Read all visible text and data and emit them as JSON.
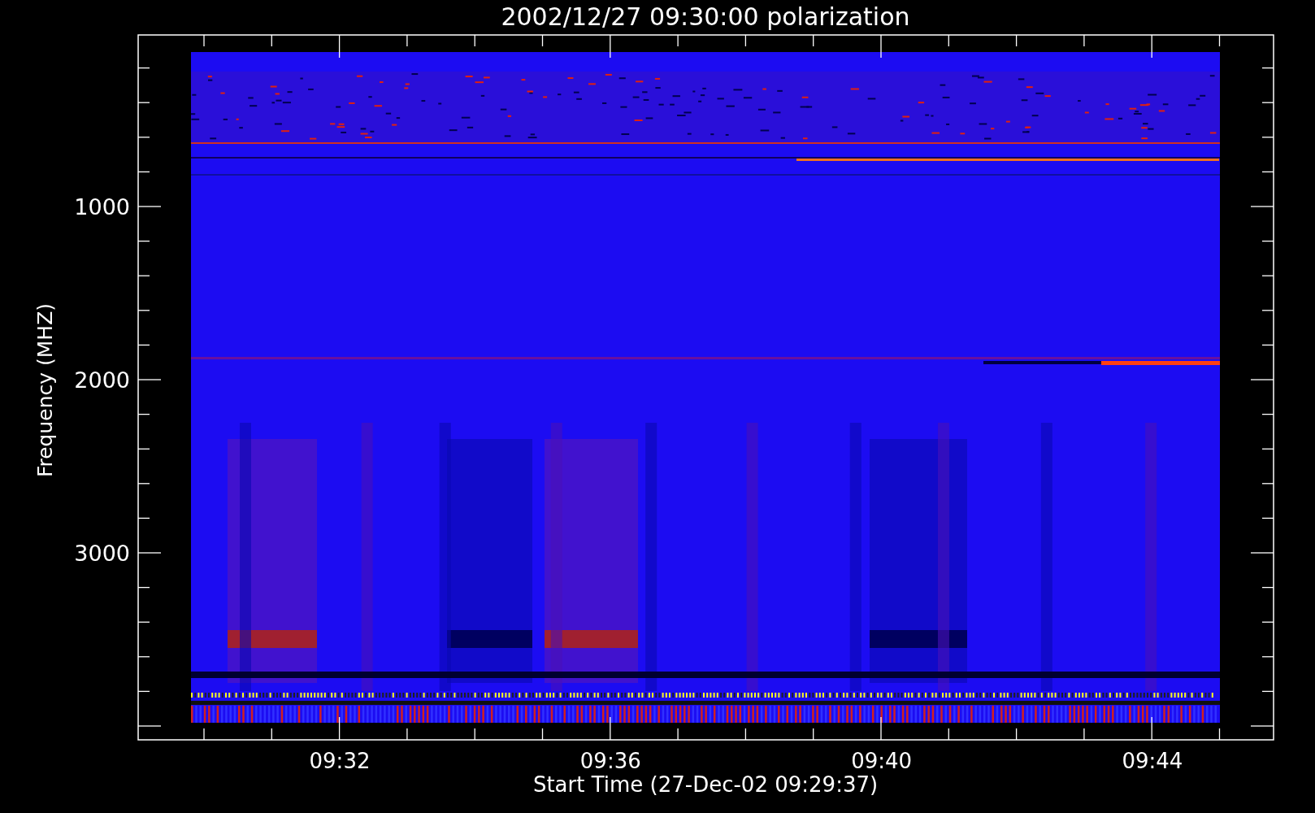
{
  "title": "2002/12/27 09:30:00 polarization",
  "y_axis": {
    "label": "Frequency (MHZ)",
    "tick_labels": [
      "1000",
      "2000",
      "3000"
    ]
  },
  "x_axis": {
    "label": "Start Time (27-Dec-02 09:29:37)",
    "tick_labels": [
      "09:32",
      "09:36",
      "09:40",
      "09:44"
    ]
  }
}
